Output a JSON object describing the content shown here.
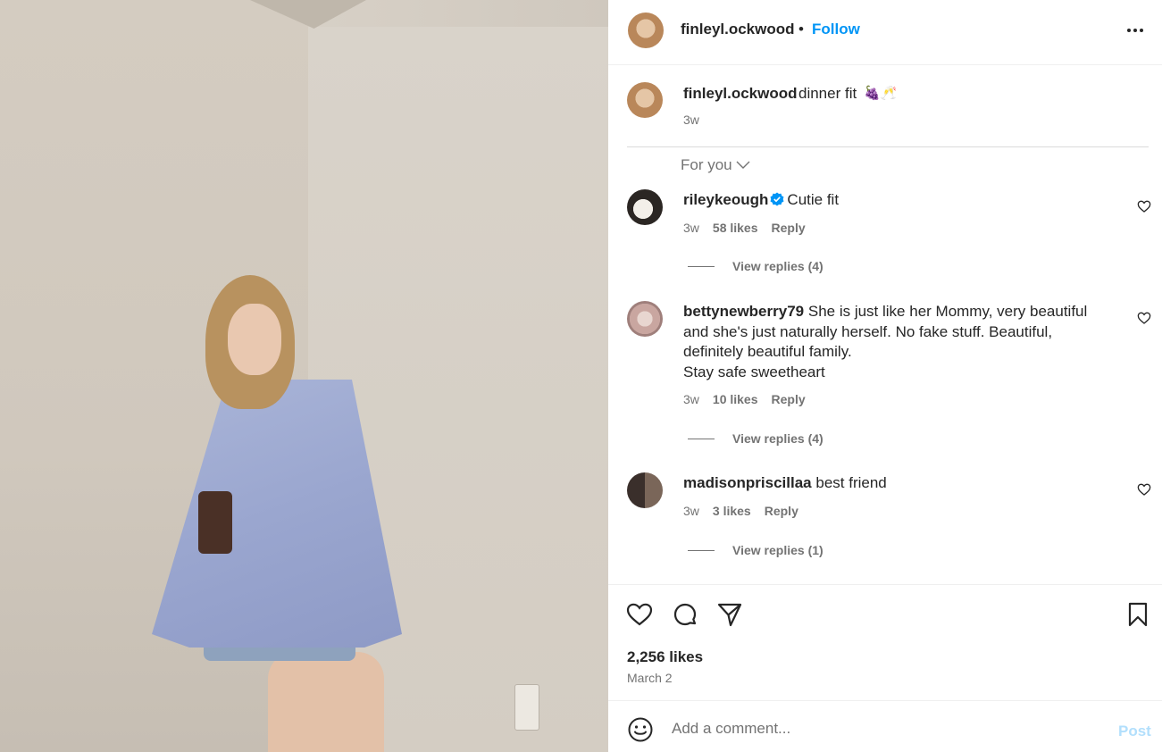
{
  "post": {
    "owner": "finleyl.ockwood",
    "separator": "•",
    "follow_label": "Follow",
    "caption_text": "dinner fit",
    "caption_emoji": "🍇🥂",
    "caption_time": "3w",
    "sort_label": "For you"
  },
  "comments": [
    {
      "user": "rileykeough",
      "verified": true,
      "text": "Cutie fit",
      "time": "3w",
      "likes": "58 likes",
      "reply": "Reply",
      "replies": "View replies (4)"
    },
    {
      "user": "bettynewberry79",
      "verified": false,
      "text": "She is just like her Mommy, very beautiful and she's just naturally herself. No fake stuff. Beautiful, definitely beautiful family.",
      "text2": "Stay safe sweetheart",
      "time": "3w",
      "likes": "10 likes",
      "reply": "Reply",
      "replies": "View replies (4)"
    },
    {
      "user": "madisonpriscillaa",
      "verified": false,
      "text": "best friend",
      "time": "3w",
      "likes": "3 likes",
      "reply": "Reply",
      "replies": "View replies (1)"
    }
  ],
  "footer": {
    "likes": "2,256 likes",
    "date": "March 2",
    "comment_placeholder": "Add a comment...",
    "post_label": "Post"
  },
  "icons": {
    "more": "more-options-icon",
    "like": "heart-icon",
    "comment": "comment-icon",
    "share": "share-icon",
    "save": "bookmark-icon",
    "emoji": "emoji-icon"
  },
  "colors": {
    "accent": "#0095f6",
    "muted": "#737373",
    "post_disabled": "#b2dffc",
    "text": "#262626"
  }
}
